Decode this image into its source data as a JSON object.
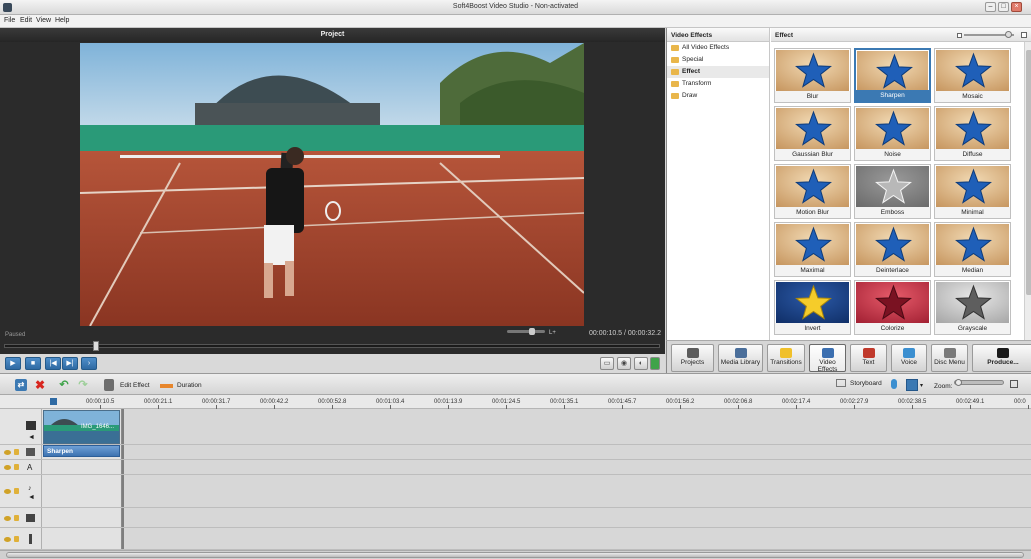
{
  "window": {
    "title": "Soft4Boost Video Studio - Non-activated"
  },
  "menu": [
    "File",
    "Edit",
    "View",
    "Help"
  ],
  "preview": {
    "header": "Project",
    "status": "Paused",
    "timecode": "00:00:10.5 / 00:00:32.2",
    "volume_label": "L+"
  },
  "effects_list": {
    "header": "Video Effects",
    "items": [
      "All Video Effects",
      "Special",
      "Effect",
      "Transform",
      "Draw"
    ],
    "selected": "Effect"
  },
  "effects_grid": {
    "header": "Effect",
    "tiles": [
      {
        "label": "Blur",
        "style": "star"
      },
      {
        "label": "Sharpen",
        "style": "star",
        "selected": true
      },
      {
        "label": "Mosaic",
        "style": "star"
      },
      {
        "label": "Gaussian Blur",
        "style": "star"
      },
      {
        "label": "Noise",
        "style": "star"
      },
      {
        "label": "Diffuse",
        "style": "star"
      },
      {
        "label": "Motion Blur",
        "style": "star"
      },
      {
        "label": "Emboss",
        "style": "emboss"
      },
      {
        "label": "Minimal",
        "style": "star"
      },
      {
        "label": "Maximal",
        "style": "star"
      },
      {
        "label": "Deinterlace",
        "style": "star"
      },
      {
        "label": "Median",
        "style": "star"
      },
      {
        "label": "Invert",
        "style": "invert"
      },
      {
        "label": "Colorize",
        "style": "colorize"
      },
      {
        "label": "Grayscale",
        "style": "grayscale"
      }
    ]
  },
  "tabs": [
    {
      "label": "Projects",
      "icon": "projects-icon",
      "color": "#5b5b5b"
    },
    {
      "label": "Media Library",
      "icon": "media-library-icon",
      "color": "#4a6e9a"
    },
    {
      "label": "Transitions",
      "icon": "transitions-icon",
      "color": "#f0c02a"
    },
    {
      "label": "Video Effects",
      "icon": "video-effects-icon",
      "color": "#3c6fb0",
      "active": true
    },
    {
      "label": "Text",
      "icon": "text-icon",
      "color": "#c0392b"
    },
    {
      "label": "Voice",
      "icon": "voice-icon",
      "color": "#3b8fd0"
    },
    {
      "label": "Disc Menu",
      "icon": "disc-menu-icon",
      "color": "#7a7a7a"
    },
    {
      "label": "Produce...",
      "icon": "produce-icon",
      "color": "#1a1a1a"
    }
  ],
  "timeline_toolbar": {
    "edit_effect": "Edit Effect",
    "duration": "Duration",
    "storyboard": "Storyboard",
    "zoom": "Zoom:"
  },
  "ruler": [
    "00:00:10.5",
    "00:00:21.1",
    "00:00:31.7",
    "00:00:42.2",
    "00:00:52.8",
    "00:01:03.4",
    "00:01:13.9",
    "00:01:24.5",
    "00:01:35.1",
    "00:01:45.7",
    "00:01:56.2",
    "00:02:06.8",
    "00:02:17.4",
    "00:02:27.9",
    "00:02:38.5",
    "00:02:49.1",
    "00:0"
  ],
  "tracks": {
    "clip_name": "IMG_1646...",
    "effect_bar": "Sharpen",
    "text_track_icon": "A"
  },
  "colors": {
    "accent": "#3b79b3",
    "star_blue": "#1f5fb8",
    "tile_bg": "#e8c79a"
  }
}
